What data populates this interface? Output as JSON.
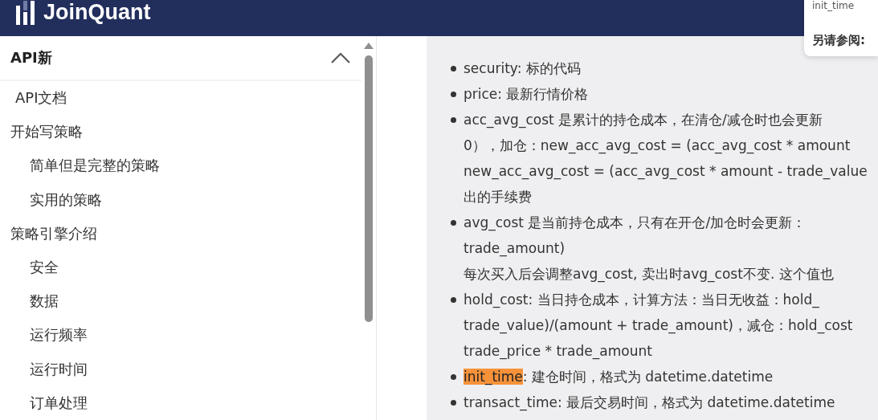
{
  "header": {
    "logo_text": "JoinQuant"
  },
  "popup": {
    "title": "init_time",
    "see_also": "另请参阅:"
  },
  "sidebar": {
    "title": "API新",
    "expanded": true,
    "items": [
      {
        "label": "API文档"
      },
      {
        "label": "开始写策略",
        "children": [
          {
            "label": "简单但是完整的策略"
          },
          {
            "label": "实用的策略"
          }
        ]
      },
      {
        "label": "策略引擎介绍",
        "children": [
          {
            "label": "安全"
          },
          {
            "label": "数据"
          },
          {
            "label": "运行频率"
          },
          {
            "label": "运行时间"
          },
          {
            "label": "订单处理"
          }
        ]
      }
    ]
  },
  "content": {
    "items": [
      {
        "term": "security",
        "highlighted": false,
        "lines": [
          ": 标的代码"
        ]
      },
      {
        "term": "price",
        "highlighted": false,
        "lines": [
          ": 最新行情价格"
        ]
      },
      {
        "term": "acc_avg_cost",
        "highlighted": false,
        "lines": [
          " 是累计的持仓成本，在清仓/减仓时也会更新",
          "0），加仓：new_acc_avg_cost = (acc_avg_cost * amount",
          "new_acc_avg_cost = (acc_avg_cost * amount - trade_value",
          "出的手续费"
        ]
      },
      {
        "term": "avg_cost",
        "highlighted": false,
        "lines": [
          " 是当前持仓成本，只有在开仓/加仓时会更新：",
          "trade_amount)",
          "每次买入后会调整avg_cost, 卖出时avg_cost不变. 这个值也"
        ]
      },
      {
        "term": "hold_cost",
        "highlighted": false,
        "lines": [
          ": 当日持仓成本，计算方法：当日无收益：hold_",
          "trade_value)/(amount + trade_amount)，减仓：hold_cost",
          "trade_price * trade_amount"
        ]
      },
      {
        "term": "init_time",
        "highlighted": true,
        "lines": [
          ": 建仓时间，格式为 datetime.datetime"
        ]
      },
      {
        "term": "transact_time",
        "highlighted": false,
        "lines": [
          ": 最后交易时间，格式为 datetime.datetime"
        ]
      }
    ]
  }
}
